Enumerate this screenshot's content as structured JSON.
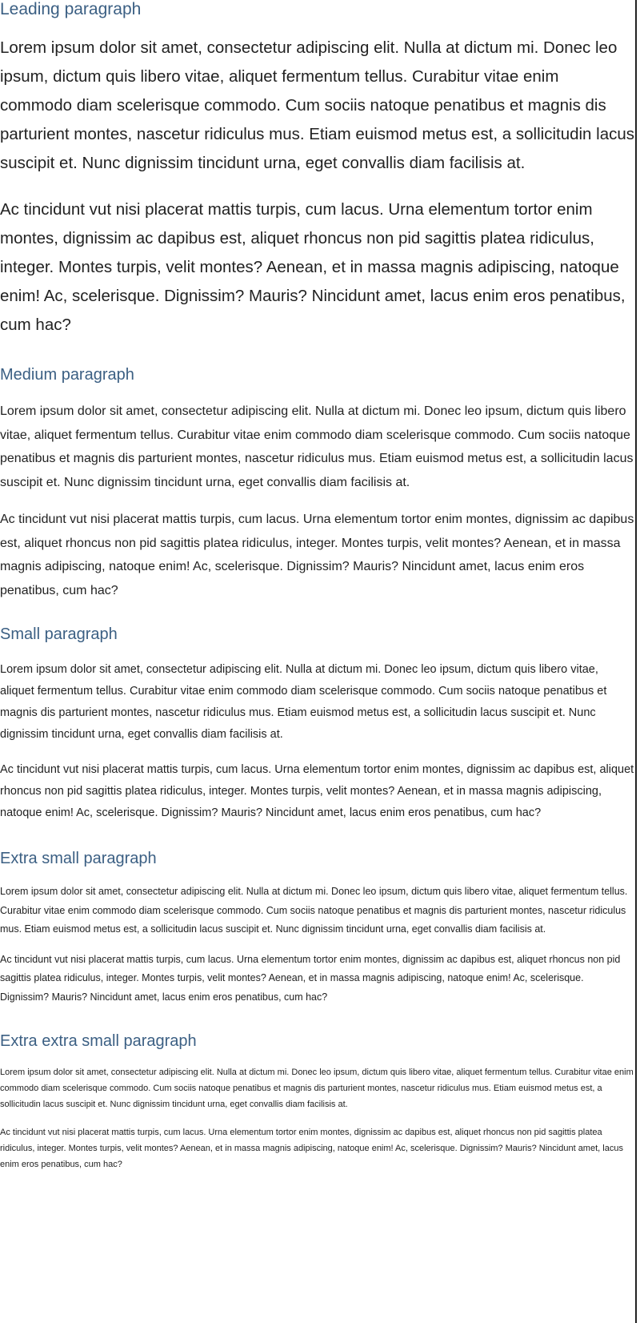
{
  "sections": [
    {
      "title": "Leading paragraph",
      "paragraphs": [
        "Lorem ipsum dolor sit amet, consectetur adipiscing elit. Nulla at dictum mi. Donec leo ipsum, dictum quis libero vitae, aliquet fermentum tellus. Curabitur vitae enim commodo diam scelerisque commodo. Cum sociis natoque penatibus et magnis dis parturient montes, nascetur ridiculus mus. Etiam euismod metus est, a sollicitudin lacus suscipit et. Nunc dignissim tincidunt urna, eget convallis diam facilisis at.",
        "Ac tincidunt vut nisi placerat mattis turpis, cum lacus. Urna elementum tortor enim montes, dignissim ac dapibus est, aliquet rhoncus non pid sagittis platea ridiculus, integer. Montes turpis, velit montes? Aenean, et in massa magnis adipiscing, natoque enim! Ac, scelerisque. Dignissim? Mauris? Nincidunt amet, lacus enim eros penatibus, cum hac?"
      ]
    },
    {
      "title": "Medium paragraph",
      "paragraphs": [
        "Lorem ipsum dolor sit amet, consectetur adipiscing elit. Nulla at dictum mi. Donec leo ipsum, dictum quis libero vitae, aliquet fermentum tellus. Curabitur vitae enim commodo diam scelerisque commodo. Cum sociis natoque penatibus et magnis dis parturient montes, nascetur ridiculus mus. Etiam euismod metus est, a sollicitudin lacus suscipit et. Nunc dignissim tincidunt urna, eget convallis diam facilisis at.",
        "Ac tincidunt vut nisi placerat mattis turpis, cum lacus. Urna elementum tortor enim montes, dignissim ac dapibus est, aliquet rhoncus non pid sagittis platea ridiculus, integer. Montes turpis, velit montes? Aenean, et in massa magnis adipiscing, natoque enim! Ac, scelerisque. Dignissim? Mauris? Nincidunt amet, lacus enim eros penatibus, cum hac?"
      ]
    },
    {
      "title": "Small paragraph",
      "paragraphs": [
        "Lorem ipsum dolor sit amet, consectetur adipiscing elit. Nulla at dictum mi. Donec leo ipsum, dictum quis libero vitae, aliquet fermentum tellus. Curabitur vitae enim commodo diam scelerisque commodo. Cum sociis natoque penatibus et magnis dis parturient montes, nascetur ridiculus mus. Etiam euismod metus est, a sollicitudin lacus suscipit et. Nunc dignissim tincidunt urna, eget convallis diam facilisis at.",
        "Ac tincidunt vut nisi placerat mattis turpis, cum lacus. Urna elementum tortor enim montes, dignissim ac dapibus est, aliquet rhoncus non pid sagittis platea ridiculus, integer. Montes turpis, velit montes? Aenean, et in massa magnis adipiscing, natoque enim! Ac, scelerisque. Dignissim? Mauris? Nincidunt amet, lacus enim eros penatibus, cum hac?"
      ]
    },
    {
      "title": "Extra small paragraph",
      "paragraphs": [
        "Lorem ipsum dolor sit amet, consectetur adipiscing elit. Nulla at dictum mi. Donec leo ipsum, dictum quis libero vitae, aliquet fermentum tellus. Curabitur vitae enim commodo diam scelerisque commodo. Cum sociis natoque penatibus et magnis dis parturient montes, nascetur ridiculus mus. Etiam euismod metus est, a sollicitudin lacus suscipit et. Nunc dignissim tincidunt urna, eget convallis diam facilisis at.",
        "Ac tincidunt vut nisi placerat mattis turpis, cum lacus. Urna elementum tortor enim montes, dignissim ac dapibus est, aliquet rhoncus non pid sagittis platea ridiculus, integer. Montes turpis, velit montes? Aenean, et in massa magnis adipiscing, natoque enim! Ac, scelerisque. Dignissim? Mauris? Nincidunt amet, lacus enim eros penatibus, cum hac?"
      ]
    },
    {
      "title": "Extra extra small paragraph",
      "paragraphs": [
        "Lorem ipsum dolor sit amet, consectetur adipiscing elit. Nulla at dictum mi. Donec leo ipsum, dictum quis libero vitae, aliquet fermentum tellus. Curabitur vitae enim commodo diam scelerisque commodo. Cum sociis natoque penatibus et magnis dis parturient montes, nascetur ridiculus mus. Etiam euismod metus est, a sollicitudin lacus suscipit et. Nunc dignissim tincidunt urna, eget convallis diam facilisis at.",
        "Ac tincidunt vut nisi placerat mattis turpis, cum lacus. Urna elementum tortor enim montes, dignissim ac dapibus est, aliquet rhoncus non pid sagittis platea ridiculus, integer. Montes turpis, velit montes? Aenean, et in massa magnis adipiscing, natoque enim! Ac, scelerisque. Dignissim? Mauris? Nincidunt amet, lacus enim eros penatibus, cum hac?"
      ]
    }
  ],
  "colors": {
    "heading": "#3b5f83",
    "text": "#222222",
    "background": "#ffffff"
  }
}
